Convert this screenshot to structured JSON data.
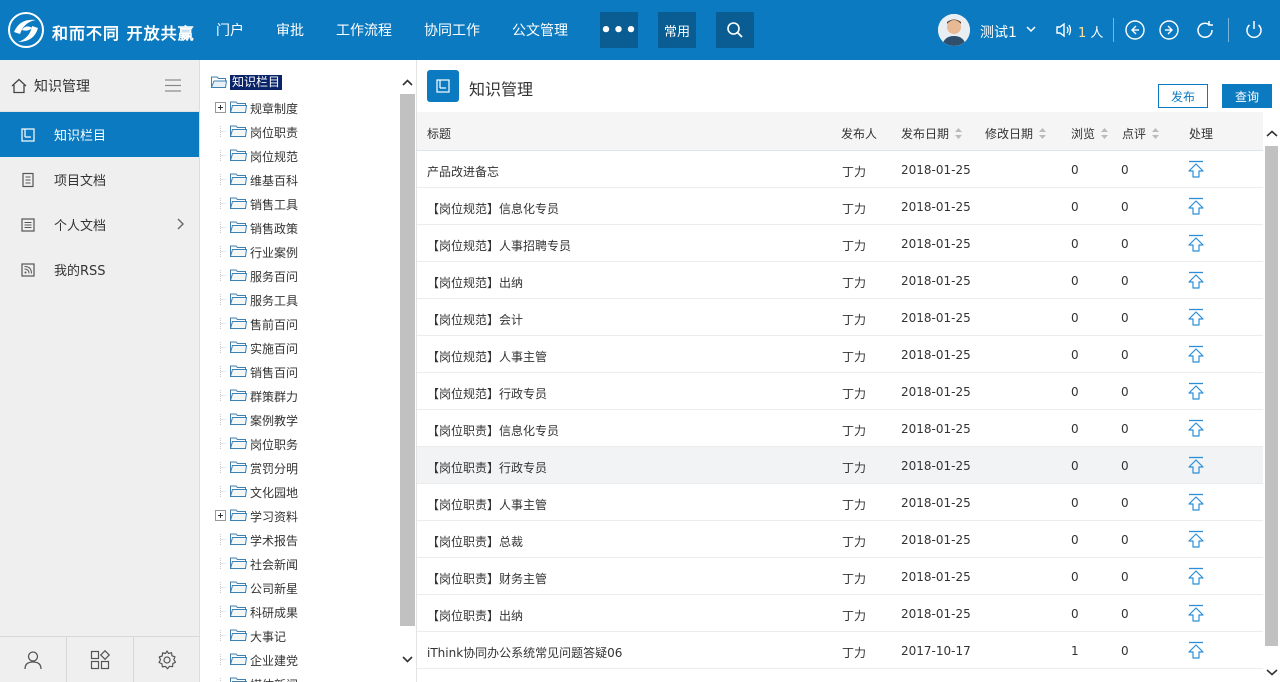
{
  "brand": {
    "name": "和而不同 开放共赢"
  },
  "nav": [
    "门户",
    "审批",
    "工作流程",
    "协同工作",
    "公文管理"
  ],
  "more_label": "•••",
  "common_label": "常用",
  "user": {
    "name": "测试1",
    "online_count": "1",
    "online_unit": "人"
  },
  "sidebar": {
    "title": "知识管理",
    "items": [
      {
        "label": "知识栏目",
        "active": true
      },
      {
        "label": "项目文档"
      },
      {
        "label": "个人文档",
        "has_arrow": true
      },
      {
        "label": "我的RSS"
      }
    ]
  },
  "tree": {
    "root": "知识栏目",
    "nodes": [
      {
        "label": "规章制度",
        "expandable": true
      },
      {
        "label": "岗位职责"
      },
      {
        "label": "岗位规范"
      },
      {
        "label": "维基百科"
      },
      {
        "label": "销售工具"
      },
      {
        "label": "销售政策"
      },
      {
        "label": "行业案例"
      },
      {
        "label": "服务百问"
      },
      {
        "label": "服务工具"
      },
      {
        "label": "售前百问"
      },
      {
        "label": "实施百问"
      },
      {
        "label": "销售百问"
      },
      {
        "label": "群策群力"
      },
      {
        "label": "案例教学"
      },
      {
        "label": "岗位职务"
      },
      {
        "label": "赏罚分明"
      },
      {
        "label": "文化园地"
      },
      {
        "label": "学习资料",
        "expandable": true
      },
      {
        "label": "学术报告"
      },
      {
        "label": "社会新闻"
      },
      {
        "label": "公司新星"
      },
      {
        "label": "科研成果"
      },
      {
        "label": "大事记"
      },
      {
        "label": "企业建党"
      },
      {
        "label": "媒体新闻"
      }
    ]
  },
  "main": {
    "title": "知识管理",
    "publish_label": "发布",
    "query_label": "查询",
    "columns": {
      "title": "标题",
      "publisher": "发布人",
      "publish_date": "发布日期",
      "modify_date": "修改日期",
      "views": "浏览",
      "comments": "点评",
      "action": "处理"
    },
    "rows": [
      {
        "title": "产品改进备忘",
        "publisher": "丁力",
        "date": "2018-01-25",
        "modified": "",
        "views": "0",
        "comments": "0"
      },
      {
        "title": "【岗位规范】信息化专员",
        "publisher": "丁力",
        "date": "2018-01-25",
        "modified": "",
        "views": "0",
        "comments": "0"
      },
      {
        "title": "【岗位规范】人事招聘专员",
        "publisher": "丁力",
        "date": "2018-01-25",
        "modified": "",
        "views": "0",
        "comments": "0"
      },
      {
        "title": "【岗位规范】出纳",
        "publisher": "丁力",
        "date": "2018-01-25",
        "modified": "",
        "views": "0",
        "comments": "0"
      },
      {
        "title": "【岗位规范】会计",
        "publisher": "丁力",
        "date": "2018-01-25",
        "modified": "",
        "views": "0",
        "comments": "0"
      },
      {
        "title": "【岗位规范】人事主管",
        "publisher": "丁力",
        "date": "2018-01-25",
        "modified": "",
        "views": "0",
        "comments": "0"
      },
      {
        "title": "【岗位规范】行政专员",
        "publisher": "丁力",
        "date": "2018-01-25",
        "modified": "",
        "views": "0",
        "comments": "0"
      },
      {
        "title": "【岗位职责】信息化专员",
        "publisher": "丁力",
        "date": "2018-01-25",
        "modified": "",
        "views": "0",
        "comments": "0"
      },
      {
        "title": "【岗位职责】行政专员",
        "publisher": "丁力",
        "date": "2018-01-25",
        "modified": "",
        "views": "0",
        "comments": "0",
        "highlight": true
      },
      {
        "title": "【岗位职责】人事主管",
        "publisher": "丁力",
        "date": "2018-01-25",
        "modified": "",
        "views": "0",
        "comments": "0"
      },
      {
        "title": "【岗位职责】总裁",
        "publisher": "丁力",
        "date": "2018-01-25",
        "modified": "",
        "views": "0",
        "comments": "0"
      },
      {
        "title": "【岗位职责】财务主管",
        "publisher": "丁力",
        "date": "2018-01-25",
        "modified": "",
        "views": "0",
        "comments": "0"
      },
      {
        "title": "【岗位职责】出纳",
        "publisher": "丁力",
        "date": "2018-01-25",
        "modified": "",
        "views": "0",
        "comments": "0"
      },
      {
        "title": "iThink协同办公系统常见问题答疑06",
        "publisher": "丁力",
        "date": "2017-10-17",
        "modified": "",
        "views": "1",
        "comments": "0"
      }
    ]
  },
  "colors": {
    "primary": "#0b7ac0",
    "primary_dark": "#0a5d92",
    "tree_selected": "#0a246a"
  }
}
